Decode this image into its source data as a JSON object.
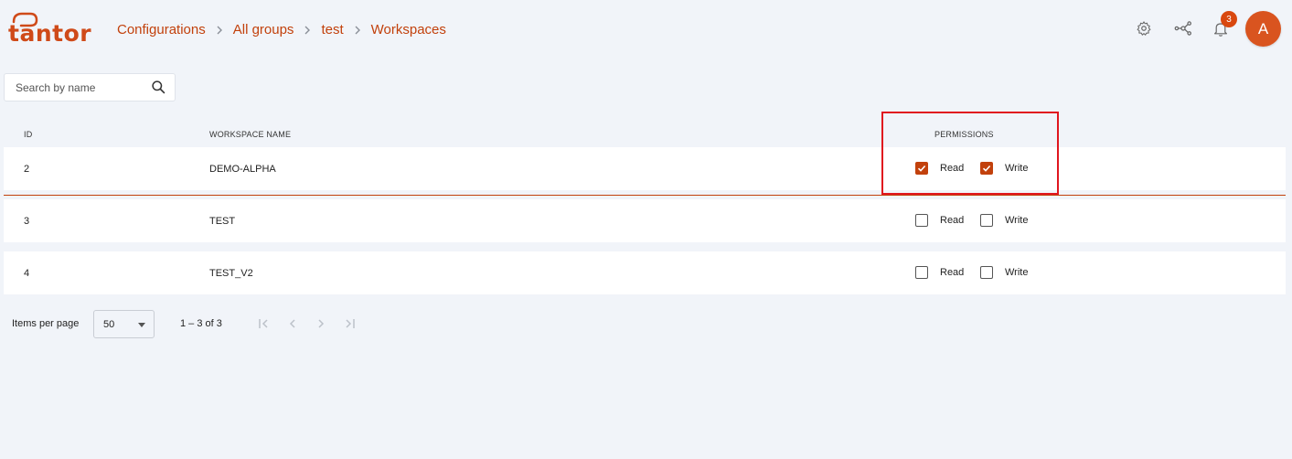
{
  "app": {
    "logo_text": "tantor",
    "brand_color": "#c2410c"
  },
  "breadcrumb": {
    "items": [
      "Configurations",
      "All groups",
      "test",
      "Workspaces"
    ]
  },
  "header": {
    "notifications_count": "3",
    "avatar_initial": "A",
    "icons": [
      "gear-icon",
      "network-icon",
      "bell-icon"
    ]
  },
  "search": {
    "placeholder": "Search by name",
    "value": ""
  },
  "table": {
    "columns": {
      "id": "ID",
      "name": "WORKSPACE NAME",
      "permissions": "PERMISSIONS"
    },
    "rows": [
      {
        "id": "2",
        "name": "DEMO-ALPHA",
        "read_label": "Read",
        "write_label": "Write",
        "read": true,
        "write": true
      },
      {
        "id": "3",
        "name": "TEST",
        "read_label": "Read",
        "write_label": "Write",
        "read": false,
        "write": false
      },
      {
        "id": "4",
        "name": "TEST_V2",
        "read_label": "Read",
        "write_label": "Write",
        "read": false,
        "write": false
      }
    ]
  },
  "paginator": {
    "items_per_page_label": "Items per page",
    "page_size": "50",
    "range_label": "1 – 3 of 3"
  }
}
